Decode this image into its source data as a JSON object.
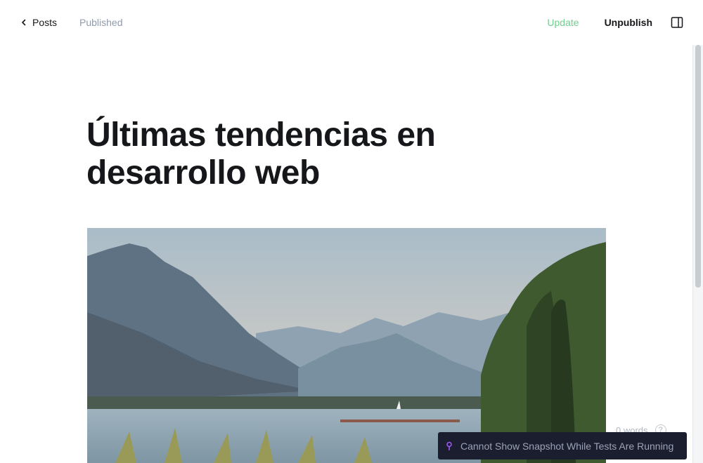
{
  "header": {
    "back_label": "Posts",
    "status": "Published",
    "update_label": "Update",
    "unpublish_label": "Unpublish",
    "back_icon": "chevron-left-icon",
    "sidebar_icon": "sidebar-toggle-icon"
  },
  "post": {
    "title": "Últimas tendencias en desarrollo web",
    "feature_image_description": "lake-mountains-landscape"
  },
  "footer": {
    "word_count": "0 words",
    "help_symbol": "?"
  },
  "toast": {
    "message": "Cannot Show Snapshot While Tests Are Running",
    "icon": "pin-icon"
  },
  "colors": {
    "accent_green": "#6fcf8e",
    "text": "#15171a",
    "muted": "#8e9cac",
    "toast_bg": "#1b1e2e",
    "toast_icon": "#a259ff"
  }
}
